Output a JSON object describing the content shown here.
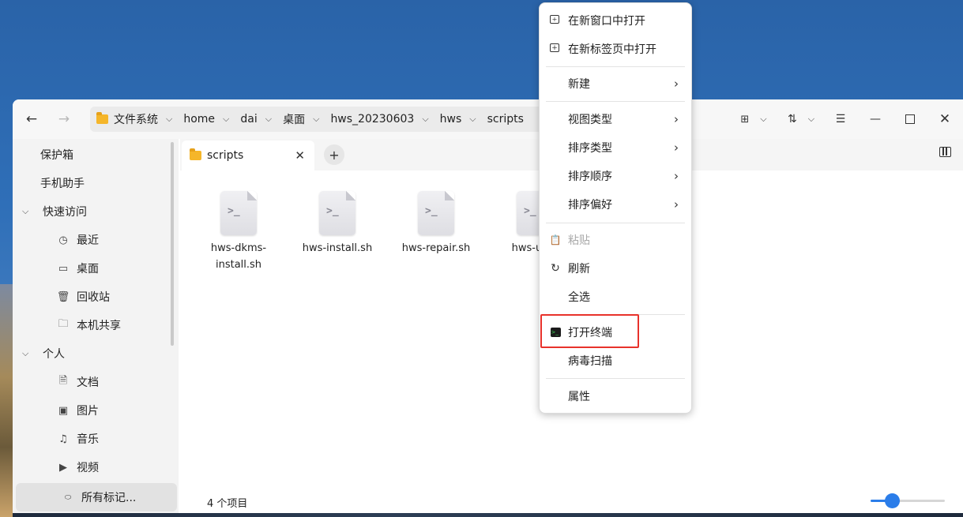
{
  "breadcrumb": [
    {
      "label": "文件系统",
      "has_icon": true
    },
    {
      "label": "home"
    },
    {
      "label": "dai"
    },
    {
      "label": "桌面"
    },
    {
      "label": "hws_20230603"
    },
    {
      "label": "hws"
    },
    {
      "label": "scripts"
    }
  ],
  "sidebar": {
    "items": [
      {
        "label": "保护箱",
        "icon": "vault-icon"
      },
      {
        "label": "手机助手",
        "icon": "phone-icon"
      },
      {
        "label": "快速访问",
        "icon": "chevron-down-icon",
        "group": true
      },
      {
        "label": "最近",
        "icon": "clock-icon"
      },
      {
        "label": "桌面",
        "icon": "desktop-icon"
      },
      {
        "label": "回收站",
        "icon": "trash-icon"
      },
      {
        "label": "本机共享",
        "icon": "folder-share-icon"
      },
      {
        "label": "个人",
        "icon": "chevron-down-icon",
        "group": true
      },
      {
        "label": "文档",
        "icon": "document-icon"
      },
      {
        "label": "图片",
        "icon": "image-icon"
      },
      {
        "label": "音乐",
        "icon": "music-icon"
      },
      {
        "label": "视频",
        "icon": "video-icon"
      },
      {
        "label": "所有标记...",
        "icon": "tag-icon",
        "selected": true
      }
    ]
  },
  "tab": {
    "label": "scripts"
  },
  "files": [
    {
      "name": "hws-dkms-\ninstall.sh",
      "line1": "hws-dkms-",
      "line2": "install.sh"
    },
    {
      "name": "hws-install.sh",
      "line1": "hws-install.sh",
      "line2": ""
    },
    {
      "name": "hws-repair.sh",
      "line1": "hws-repair.sh",
      "line2": ""
    },
    {
      "name": "hws-unin",
      "line1": "hws-unin",
      "line2": ""
    }
  ],
  "status": {
    "count": "4 个项目"
  },
  "zoom": {
    "level_fraction": 0.28
  },
  "context_menu": {
    "items": [
      {
        "label": "在新窗口中打开",
        "icon": "new-window-icon"
      },
      {
        "label": "在新标签页中打开",
        "icon": "new-tab-icon"
      },
      {
        "label": "新建",
        "submenu": true
      },
      {
        "label": "视图类型",
        "submenu": true
      },
      {
        "label": "排序类型",
        "submenu": true
      },
      {
        "label": "排序顺序",
        "submenu": true
      },
      {
        "label": "排序偏好",
        "submenu": true
      },
      {
        "label": "粘贴",
        "icon": "paste-icon",
        "disabled": true
      },
      {
        "label": "刷新",
        "icon": "refresh-icon"
      },
      {
        "label": "全选"
      },
      {
        "label": "打开终端",
        "icon": "terminal-icon",
        "highlighted": true
      },
      {
        "label": "病毒扫描"
      },
      {
        "label": "属性"
      }
    ]
  },
  "colors": {
    "accent": "#2b7de9",
    "highlight_border": "#e8322b",
    "folder": "#f5b62a"
  }
}
